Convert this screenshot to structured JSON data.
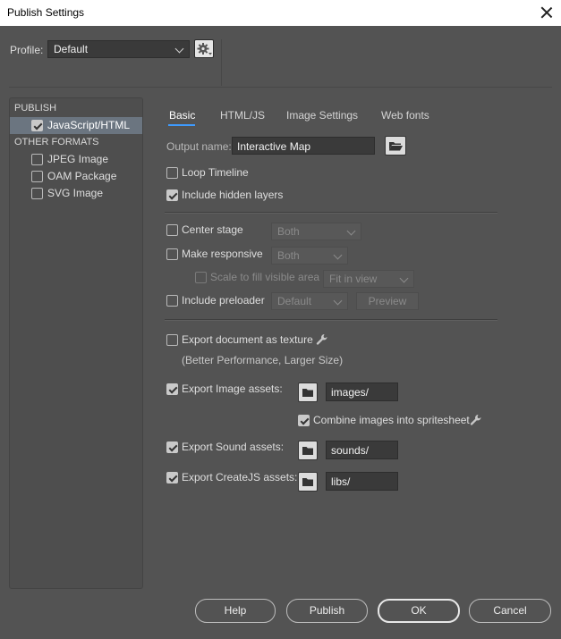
{
  "window": {
    "title": "Publish Settings"
  },
  "profile": {
    "label": "Profile:",
    "value": "Default"
  },
  "sidebar": {
    "publish_header": "PUBLISH",
    "publish_items": [
      {
        "label": "JavaScript/HTML",
        "checked": true,
        "selected": true
      }
    ],
    "other_header": "OTHER FORMATS",
    "other_items": [
      {
        "label": "JPEG Image",
        "checked": false
      },
      {
        "label": "OAM Package",
        "checked": false
      },
      {
        "label": "SVG Image",
        "checked": false
      }
    ]
  },
  "tabs": [
    {
      "label": "Basic",
      "active": true
    },
    {
      "label": "HTML/JS",
      "active": false
    },
    {
      "label": "Image Settings",
      "active": false
    },
    {
      "label": "Web fonts",
      "active": false
    }
  ],
  "basic": {
    "output_name_label": "Output name:",
    "output_name_value": "Interactive Map",
    "loop_timeline": {
      "label": "Loop Timeline",
      "checked": false
    },
    "include_hidden_layers": {
      "label": "Include hidden layers",
      "checked": true
    },
    "center_stage": {
      "label": "Center stage",
      "checked": false,
      "option": "Both"
    },
    "make_responsive": {
      "label": "Make responsive",
      "checked": false,
      "option": "Both"
    },
    "scale_to_fill": {
      "label": "Scale to fill visible area",
      "checked": false,
      "option": "Fit in view"
    },
    "include_preloader": {
      "label": "Include preloader",
      "checked": false,
      "option": "Default",
      "preview_label": "Preview"
    },
    "export_texture": {
      "label": "Export document as texture",
      "checked": false,
      "note": "(Better Performance, Larger Size)"
    },
    "export_image_assets": {
      "label": "Export Image assets:",
      "checked": true,
      "path": "images/"
    },
    "combine_spritesheet": {
      "label": "Combine images into spritesheet",
      "checked": true
    },
    "export_sound_assets": {
      "label": "Export Sound assets:",
      "checked": true,
      "path": "sounds/"
    },
    "export_createjs_assets": {
      "label": "Export CreateJS assets:",
      "checked": true,
      "path": "libs/"
    }
  },
  "buttons": {
    "help": "Help",
    "publish": "Publish",
    "ok": "OK",
    "cancel": "Cancel"
  }
}
